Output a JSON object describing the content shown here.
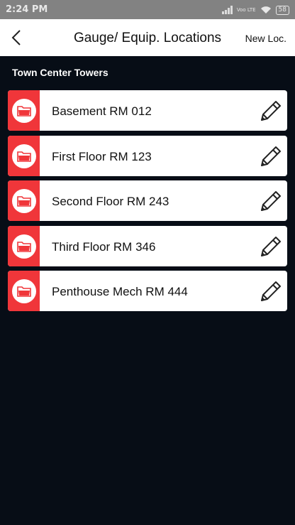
{
  "status": {
    "time": "2:24 PM",
    "network_label": "Voo LTE",
    "battery": "58"
  },
  "header": {
    "title": "Gauge/ Equip. Locations",
    "new_label": "New Loc."
  },
  "section": {
    "title": "Town Center Towers"
  },
  "locations": [
    {
      "label": "Basement RM 012"
    },
    {
      "label": "First Floor RM 123"
    },
    {
      "label": "Second Floor RM 243"
    },
    {
      "label": "Third Floor RM 346"
    },
    {
      "label": "Penthouse Mech RM 444"
    }
  ],
  "colors": {
    "accent": "#f0363a",
    "background": "#070d16",
    "statusbar": "#828282"
  }
}
